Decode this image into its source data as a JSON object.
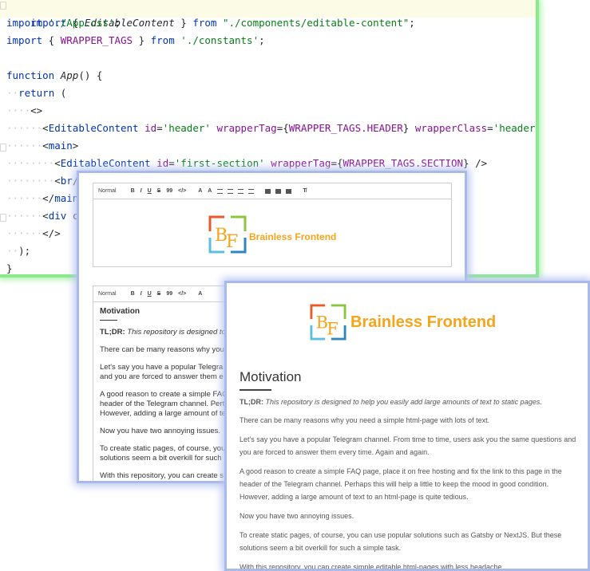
{
  "code": {
    "lines": [
      "import { EditableContent } from \"./components/editable-content\";",
      "import './App.css';",
      "import { WRAPPER_TAGS } from './constants';",
      "",
      "function App() {",
      "  return (",
      "    <>",
      "      <EditableContent id='header' wrapperTag={WRAPPER_TAGS.HEADER} wrapperClass='header-logo' />",
      "      <main>",
      "        <EditableContent id='first-section' wrapperTag={WRAPPER_TAGS.SECTION} />",
      "        <br/>",
      "      </main>",
      "      <div cl",
      "      </>",
      "  );",
      "}"
    ]
  },
  "editor": {
    "toolbar": {
      "format": "Normal",
      "buttons": [
        "B",
        "I",
        "U",
        "S",
        "99",
        "</>",
        "A",
        "A"
      ]
    },
    "logo_text": "Brainless Frontend",
    "heading": "Motivation",
    "tldr_label": "TL;DR:",
    "tldr_text": "This repository is designed to",
    "paragraphs": [
      "There can be many reasons why you",
      "Let's say you have a popular Telegra",
      "and you are forced to answer them e",
      "A good reason to create a simple FAQ",
      "header of the Telegram channel. Pert",
      "However, adding a large amount of te",
      "Now you have two annoying issues.",
      "To create static pages, of course, you",
      "solutions seem a bit overkill for such",
      "With this repository, you can create s"
    ]
  },
  "preview": {
    "logo_text": "Brainless Frontend",
    "heading": "Motivation",
    "tldr_label": "TL;DR:",
    "tldr_text": "This repository is designed to help you easily add large amounts of text to static pages.",
    "paragraphs": [
      "There can be many reasons why you need a simple html-page with lots of text.",
      "Let's say you have a popular Telegram channel. From time to time, users ask you the same questions and",
      "you are forced to answer them every time. Again and again.",
      "A good reason to create a simple FAQ page, place it on free hosting and fix the link to this page in the",
      "header of the Telegram channel. Perhaps this will help a little to keep the mood in good condition.",
      "However, adding a large amount of text to an html-page is quite tedious.",
      "Now you have two annoying issues.",
      "To create static pages, of course, you can use popular solutions such as Gatsby or NextJS. But these",
      "solutions seem a bit overkill for such a simple task.",
      "With this repository, you can create simple editable html-pages with less headache."
    ]
  },
  "colors": {
    "code_border": "#8be88b",
    "panel_border": "#a9b9ea",
    "logo_orange": "#f6a41b"
  }
}
